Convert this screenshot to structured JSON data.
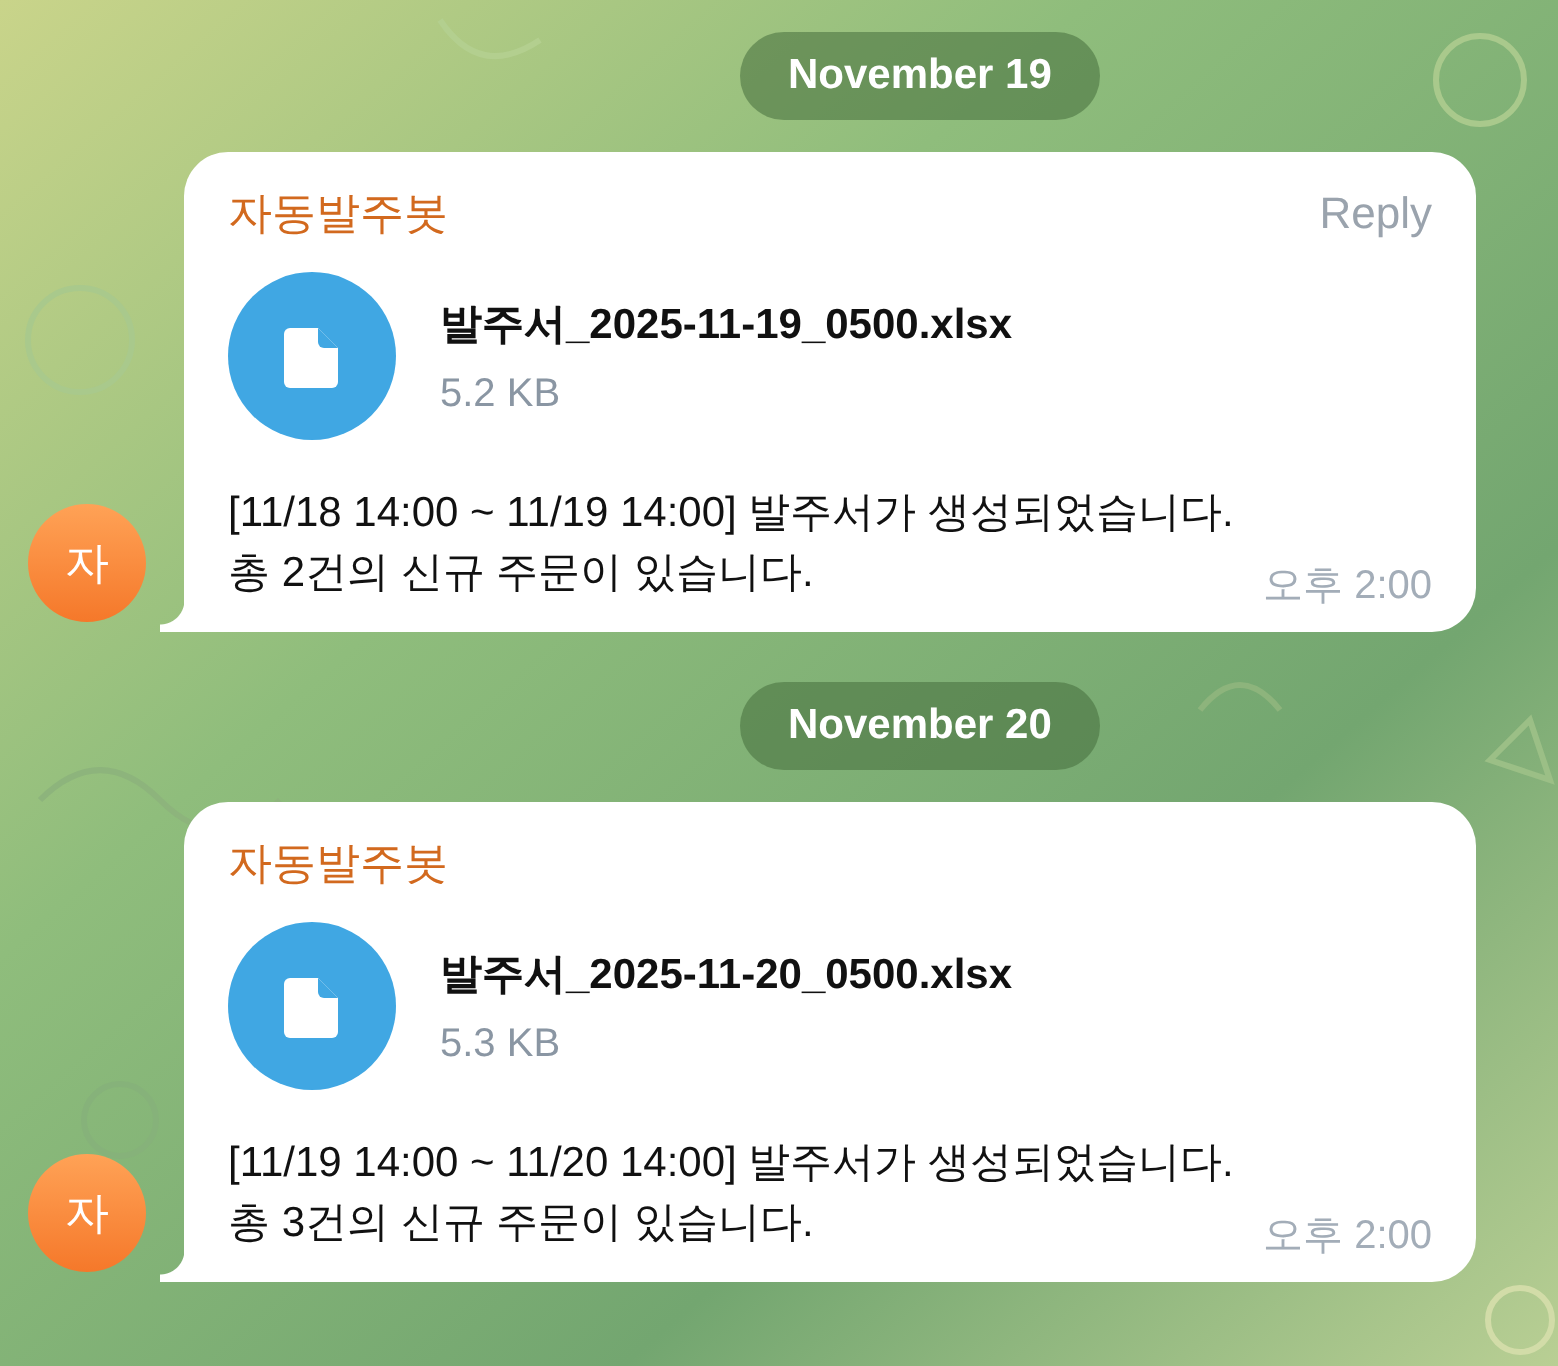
{
  "groups": [
    {
      "date": "November 19",
      "message": {
        "sender": "자동발주봇",
        "reply": "Reply",
        "file_name": "발주서_2025-11-19_0500.xlsx",
        "file_size": "5.2 KB",
        "text": "[11/18 14:00 ~ 11/19 14:00] 발주서가 생성되었습니다.\n총 2건의 신규 주문이 있습니다.",
        "time": "오후 2:00",
        "avatar": "자"
      }
    },
    {
      "date": "November 20",
      "message": {
        "sender": "자동발주봇",
        "file_name": "발주서_2025-11-20_0500.xlsx",
        "file_size": "5.3 KB",
        "text": "[11/19 14:00 ~ 11/20 14:00] 발주서가 생성되었습니다.\n총 3건의 신규 주문이 있습니다.",
        "time": "오후 2:00",
        "avatar": "자"
      }
    }
  ]
}
